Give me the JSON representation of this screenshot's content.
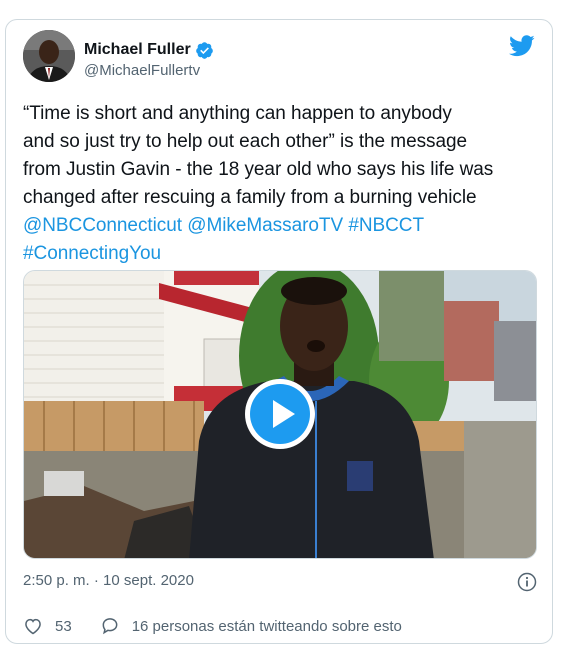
{
  "author": {
    "name": "Michael Fuller",
    "handle": "@MichaelFullertv"
  },
  "tweet": {
    "lines": [
      "“Time is short and anything can happen to anybody",
      "and so just try to help out each other” is the message",
      "from Justin Gavin - the 18 year old who says his life was",
      "changed after rescuing a family from a burning vehicle"
    ],
    "links": [
      "@NBCConnecticut",
      "@MikeMassaroTV",
      "#NBCCT",
      "#ConnectingYou"
    ]
  },
  "timestamp": "2:50 p. m. · 10 sept. 2020",
  "actions": {
    "likes": "53",
    "conversation": "16 personas están twitteando sobre esto"
  },
  "colors": {
    "accent": "#1b95e0",
    "verified": "#1d9bf0",
    "text": "#0f1419",
    "secondary": "#536471",
    "border": "#cfd9de"
  },
  "icons": [
    "verified-badge-icon",
    "twitter-bird-icon",
    "play-icon",
    "info-icon",
    "heart-icon",
    "reply-bubble-icon"
  ]
}
